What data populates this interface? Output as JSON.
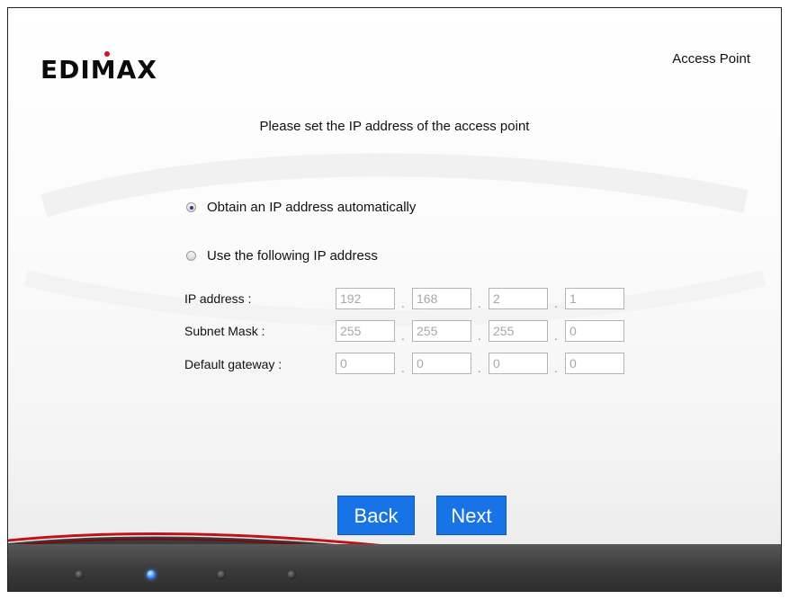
{
  "header": {
    "logo_text": "EDIMAX",
    "mode_label": "Access Point"
  },
  "main": {
    "heading": "Please set the IP address of the access point",
    "options": [
      {
        "label": "Obtain an IP address automatically",
        "selected": true
      },
      {
        "label": "Use the following IP address",
        "selected": false
      }
    ],
    "fields": [
      {
        "label": "IP address :",
        "octets": [
          "192",
          "168",
          "2",
          "1"
        ]
      },
      {
        "label": "Subnet Mask :",
        "octets": [
          "255",
          "255",
          "255",
          "0"
        ]
      },
      {
        "label": "Default gateway :",
        "octets": [
          "0",
          "0",
          "0",
          "0"
        ]
      }
    ],
    "octet_separator": "."
  },
  "buttons": {
    "back_label": "Back",
    "next_label": "Next"
  },
  "progress": {
    "step_count": 4,
    "current_step": 2,
    "colors": {
      "active": "#2f84ff",
      "inactive": "#3a3a3a"
    }
  },
  "colors": {
    "button": "#1873e6",
    "accent_red": "#c0121a",
    "bar": "#3a3a3a"
  }
}
